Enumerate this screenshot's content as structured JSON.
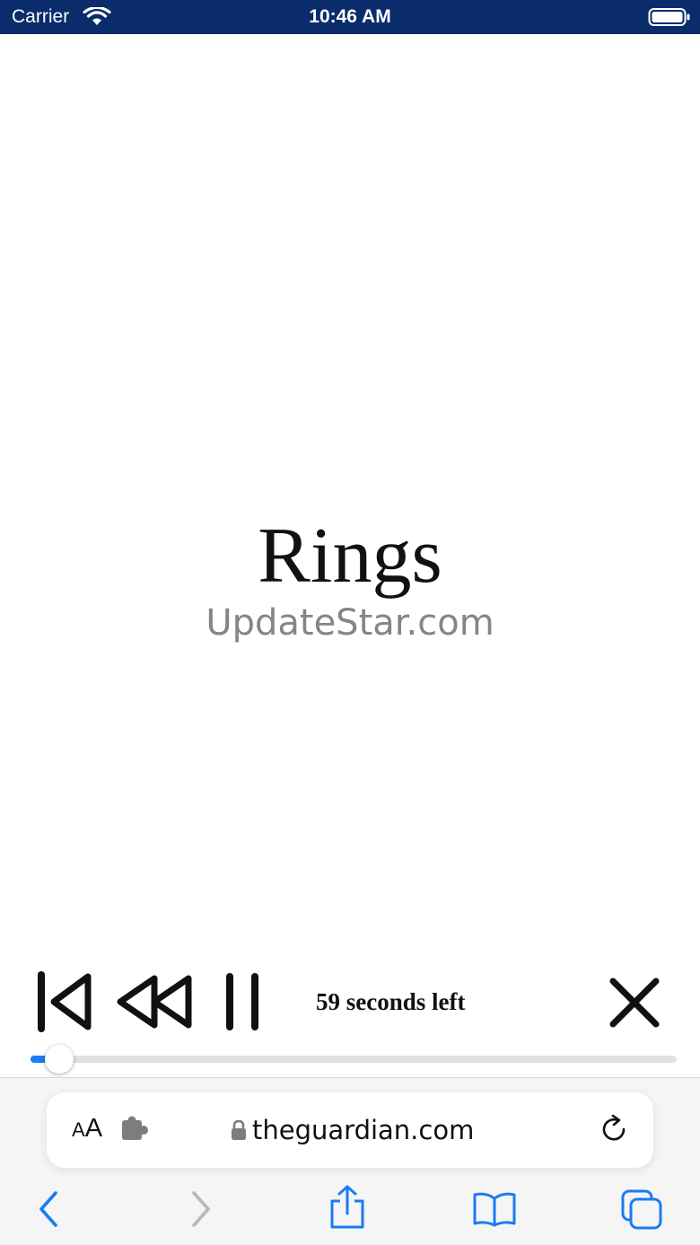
{
  "status_bar": {
    "carrier": "Carrier",
    "time": "10:46 AM",
    "background": "#0b2c6b"
  },
  "content": {
    "title": "Rings",
    "subtitle": "UpdateStar.com"
  },
  "player": {
    "time_left": "59 seconds left",
    "progress_percent": 4.5,
    "accent_color": "#1a7cf2",
    "icons": [
      "skip-back-icon",
      "rewind-icon",
      "pause-icon",
      "close-icon"
    ]
  },
  "browser": {
    "text_size_label": "AA",
    "url": "theguardian.com",
    "icons": [
      "puzzle-icon",
      "lock-icon",
      "reload-icon",
      "back-icon",
      "forward-icon",
      "share-icon",
      "bookmarks-icon",
      "tabs-icon"
    ]
  }
}
